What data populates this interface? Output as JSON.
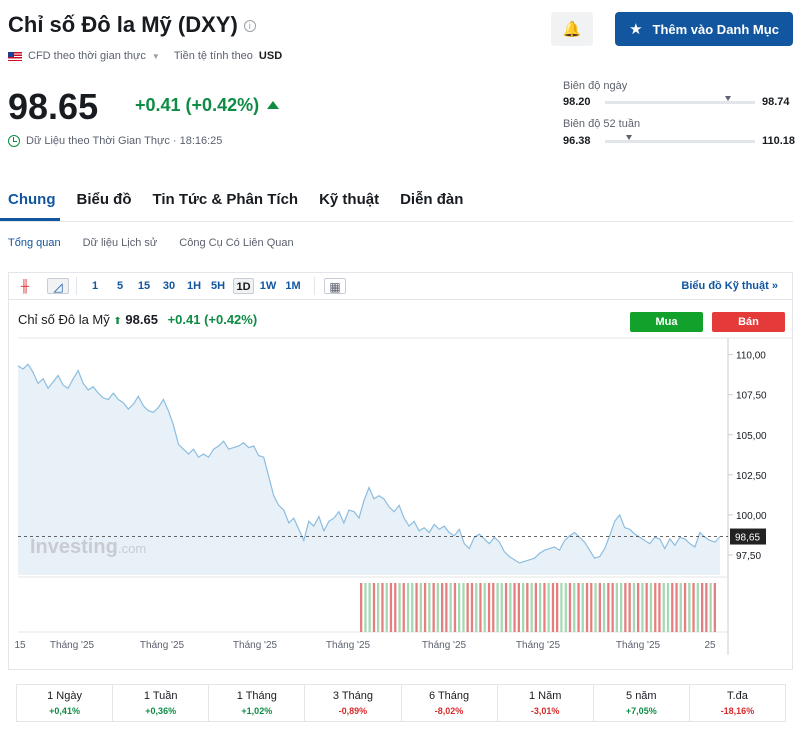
{
  "header": {
    "title": "Chỉ số Đô la Mỹ (DXY)",
    "info_glyph": "i",
    "source": "CFD theo thời gian thực",
    "currency_label": "Tiền tệ tính theo",
    "currency": "USD",
    "price": "98.65",
    "change": "+0.41 (+0.42%)",
    "realtime_label": "Dữ Liệu theo Thời Gian Thực · 18:16:25",
    "watchlist_button": "Thêm vào Danh Mục",
    "bell_glyph": "🔔",
    "star_glyph": "★"
  },
  "ranges": {
    "day": {
      "label": "Biên độ ngày",
      "low": "98.20",
      "high": "98.74",
      "position": 0.82
    },
    "week52": {
      "label": "Biên độ 52 tuần",
      "low": "96.38",
      "high": "110.18",
      "position": 0.16
    }
  },
  "tabs": [
    {
      "label": "Chung",
      "active": true
    },
    {
      "label": "Biểu đồ",
      "active": false
    },
    {
      "label": "Tin Tức & Phân Tích",
      "active": false
    },
    {
      "label": "Kỹ thuật",
      "active": false
    },
    {
      "label": "Diễn đàn",
      "active": false
    }
  ],
  "subtabs": [
    {
      "label": "Tổng quan",
      "active": true
    },
    {
      "label": "Dữ liệu Lịch sử",
      "active": false
    },
    {
      "label": "Công Cụ Có Liên Quan",
      "active": false
    }
  ],
  "toolbar": {
    "candle_glyph": "╫",
    "area_glyph": "◿",
    "table_glyph": "▦",
    "timeframes": [
      "1",
      "5",
      "15",
      "30",
      "1H",
      "5H",
      "1D",
      "1W",
      "1M"
    ],
    "active_timeframe": "1D",
    "advanced_link": "Biểu đồ Kỹ thuật",
    "advanced_arrow": "»"
  },
  "chart_header": {
    "name": "Chỉ số Đô la Mỹ",
    "up_glyph": "⬆",
    "price": "98.65",
    "change": "+0.41 (+0.42%)",
    "buy": "Mua",
    "sell": "Bán"
  },
  "chart_data": {
    "type": "area",
    "ylim": [
      96.25,
      110.6
    ],
    "yticks": [
      "110,00",
      "107,50",
      "105,00",
      "102,50",
      "100,00",
      "97,50"
    ],
    "ytick_values": [
      110,
      107.5,
      105,
      102.5,
      100,
      97.5
    ],
    "current_label": "98,65",
    "current_value": 98.65,
    "xtick_labels": [
      "15",
      "Tháng '25",
      "Tháng '25",
      "Tháng '25",
      "Tháng '25",
      "Tháng '25",
      "Tháng '25",
      "Tháng '25",
      "25"
    ],
    "watermark": "Investing",
    "watermark_suffix": ".com",
    "values": [
      109.3,
      109.1,
      109.4,
      108.9,
      108.2,
      108.5,
      107.9,
      108.3,
      108.7,
      108.1,
      107.9,
      108.5,
      109.0,
      108.2,
      107.8,
      108.0,
      107.6,
      107.3,
      107.2,
      107.6,
      107.2,
      107.0,
      106.6,
      106.9,
      107.4,
      106.8,
      106.5,
      106.4,
      106.7,
      107.2,
      106.5,
      105.6,
      104.4,
      104.1,
      103.8,
      104.1,
      103.6,
      103.8,
      103.6,
      104.1,
      104.3,
      104.6,
      104.1,
      104.2,
      104.3,
      104.5,
      104.2,
      104.3,
      103.7,
      103.6,
      102.4,
      101.2,
      100.6,
      100.3,
      99.5,
      99.8,
      99.1,
      98.4,
      99.6,
      99.3,
      99.9,
      99.0,
      99.6,
      99.8,
      100.2,
      99.5,
      100.3,
      100.2,
      99.8,
      100.9,
      101.7,
      101.0,
      101.2,
      101.0,
      100.5,
      100.2,
      100.6,
      99.8,
      99.3,
      99.6,
      99.0,
      99.2,
      98.9,
      99.4,
      99.1,
      99.3,
      98.9,
      98.7,
      99.1,
      98.2,
      97.9,
      98.6,
      98.8,
      98.5,
      98.2,
      98.6,
      98.3,
      97.7,
      97.4,
      97.2,
      97.0,
      97.1,
      97.2,
      97.3,
      97.6,
      97.8,
      97.9,
      98.0,
      97.8,
      98.4,
      98.7,
      98.9,
      98.6,
      98.3,
      97.8,
      97.3,
      97.4,
      97.9,
      98.7,
      99.6,
      100.0,
      99.2,
      99.1,
      98.8,
      98.6,
      98.4,
      98.2,
      98.6,
      98.5,
      97.9,
      98.5,
      98.1,
      98.6,
      98.5,
      98.2,
      98.0,
      98.9,
      98.6,
      98.4,
      98.3,
      98.65
    ],
    "volume_colors": [
      "r",
      "g",
      "g",
      "r",
      "g",
      "r",
      "g",
      "r",
      "r",
      "g",
      "r",
      "g",
      "g",
      "r",
      "g",
      "r",
      "g",
      "r",
      "g",
      "r",
      "r",
      "g",
      "r",
      "g",
      "g",
      "r",
      "r",
      "g",
      "r",
      "g",
      "r",
      "r",
      "g",
      "g",
      "r",
      "g",
      "r",
      "r",
      "g",
      "r",
      "g",
      "r",
      "g",
      "r",
      "g",
      "r",
      "r",
      "g",
      "g",
      "r",
      "g",
      "r",
      "g",
      "r",
      "r",
      "g",
      "r",
      "g",
      "r",
      "r",
      "g",
      "g",
      "r",
      "r",
      "g",
      "r",
      "g",
      "r",
      "g",
      "r",
      "r",
      "g",
      "g",
      "r",
      "r",
      "g",
      "r",
      "g",
      "r",
      "g",
      "r",
      "r",
      "g",
      "r"
    ]
  },
  "performance": [
    {
      "label": "1 Ngày",
      "value": "+0,41%",
      "sign": "pos"
    },
    {
      "label": "1 Tuần",
      "value": "+0,36%",
      "sign": "pos"
    },
    {
      "label": "1 Tháng",
      "value": "+1,02%",
      "sign": "pos"
    },
    {
      "label": "3 Tháng",
      "value": "-0,89%",
      "sign": "neg"
    },
    {
      "label": "6 Tháng",
      "value": "-8,02%",
      "sign": "neg"
    },
    {
      "label": "1 Năm",
      "value": "-3,01%",
      "sign": "neg"
    },
    {
      "label": "5 năm",
      "value": "+7,05%",
      "sign": "pos"
    },
    {
      "label": "T.đa",
      "value": "-18,16%",
      "sign": "neg"
    }
  ],
  "colors": {
    "accent": "#1256a0",
    "positive": "#0e8b44",
    "negative": "#d72a2a",
    "line": "#8cbde0",
    "area": "#e8f1f8",
    "vol_green": "#a6d8b4",
    "vol_red": "#e57f7f"
  }
}
